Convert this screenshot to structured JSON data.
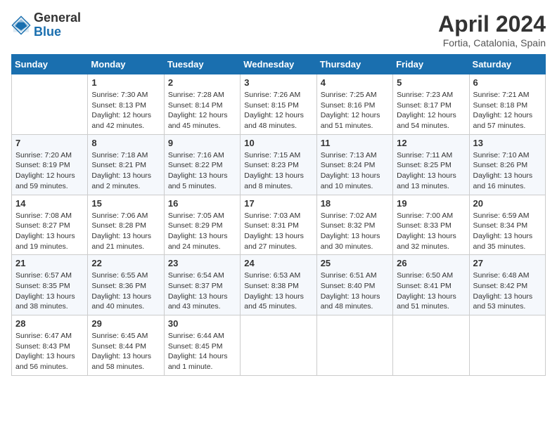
{
  "header": {
    "logo_general": "General",
    "logo_blue": "Blue",
    "month_title": "April 2024",
    "location": "Fortia, Catalonia, Spain"
  },
  "days_of_week": [
    "Sunday",
    "Monday",
    "Tuesday",
    "Wednesday",
    "Thursday",
    "Friday",
    "Saturday"
  ],
  "weeks": [
    [
      {
        "day": "",
        "info": ""
      },
      {
        "day": "1",
        "info": "Sunrise: 7:30 AM\nSunset: 8:13 PM\nDaylight: 12 hours\nand 42 minutes."
      },
      {
        "day": "2",
        "info": "Sunrise: 7:28 AM\nSunset: 8:14 PM\nDaylight: 12 hours\nand 45 minutes."
      },
      {
        "day": "3",
        "info": "Sunrise: 7:26 AM\nSunset: 8:15 PM\nDaylight: 12 hours\nand 48 minutes."
      },
      {
        "day": "4",
        "info": "Sunrise: 7:25 AM\nSunset: 8:16 PM\nDaylight: 12 hours\nand 51 minutes."
      },
      {
        "day": "5",
        "info": "Sunrise: 7:23 AM\nSunset: 8:17 PM\nDaylight: 12 hours\nand 54 minutes."
      },
      {
        "day": "6",
        "info": "Sunrise: 7:21 AM\nSunset: 8:18 PM\nDaylight: 12 hours\nand 57 minutes."
      }
    ],
    [
      {
        "day": "7",
        "info": "Sunrise: 7:20 AM\nSunset: 8:19 PM\nDaylight: 12 hours\nand 59 minutes."
      },
      {
        "day": "8",
        "info": "Sunrise: 7:18 AM\nSunset: 8:21 PM\nDaylight: 13 hours\nand 2 minutes."
      },
      {
        "day": "9",
        "info": "Sunrise: 7:16 AM\nSunset: 8:22 PM\nDaylight: 13 hours\nand 5 minutes."
      },
      {
        "day": "10",
        "info": "Sunrise: 7:15 AM\nSunset: 8:23 PM\nDaylight: 13 hours\nand 8 minutes."
      },
      {
        "day": "11",
        "info": "Sunrise: 7:13 AM\nSunset: 8:24 PM\nDaylight: 13 hours\nand 10 minutes."
      },
      {
        "day": "12",
        "info": "Sunrise: 7:11 AM\nSunset: 8:25 PM\nDaylight: 13 hours\nand 13 minutes."
      },
      {
        "day": "13",
        "info": "Sunrise: 7:10 AM\nSunset: 8:26 PM\nDaylight: 13 hours\nand 16 minutes."
      }
    ],
    [
      {
        "day": "14",
        "info": "Sunrise: 7:08 AM\nSunset: 8:27 PM\nDaylight: 13 hours\nand 19 minutes."
      },
      {
        "day": "15",
        "info": "Sunrise: 7:06 AM\nSunset: 8:28 PM\nDaylight: 13 hours\nand 21 minutes."
      },
      {
        "day": "16",
        "info": "Sunrise: 7:05 AM\nSunset: 8:29 PM\nDaylight: 13 hours\nand 24 minutes."
      },
      {
        "day": "17",
        "info": "Sunrise: 7:03 AM\nSunset: 8:31 PM\nDaylight: 13 hours\nand 27 minutes."
      },
      {
        "day": "18",
        "info": "Sunrise: 7:02 AM\nSunset: 8:32 PM\nDaylight: 13 hours\nand 30 minutes."
      },
      {
        "day": "19",
        "info": "Sunrise: 7:00 AM\nSunset: 8:33 PM\nDaylight: 13 hours\nand 32 minutes."
      },
      {
        "day": "20",
        "info": "Sunrise: 6:59 AM\nSunset: 8:34 PM\nDaylight: 13 hours\nand 35 minutes."
      }
    ],
    [
      {
        "day": "21",
        "info": "Sunrise: 6:57 AM\nSunset: 8:35 PM\nDaylight: 13 hours\nand 38 minutes."
      },
      {
        "day": "22",
        "info": "Sunrise: 6:55 AM\nSunset: 8:36 PM\nDaylight: 13 hours\nand 40 minutes."
      },
      {
        "day": "23",
        "info": "Sunrise: 6:54 AM\nSunset: 8:37 PM\nDaylight: 13 hours\nand 43 minutes."
      },
      {
        "day": "24",
        "info": "Sunrise: 6:53 AM\nSunset: 8:38 PM\nDaylight: 13 hours\nand 45 minutes."
      },
      {
        "day": "25",
        "info": "Sunrise: 6:51 AM\nSunset: 8:40 PM\nDaylight: 13 hours\nand 48 minutes."
      },
      {
        "day": "26",
        "info": "Sunrise: 6:50 AM\nSunset: 8:41 PM\nDaylight: 13 hours\nand 51 minutes."
      },
      {
        "day": "27",
        "info": "Sunrise: 6:48 AM\nSunset: 8:42 PM\nDaylight: 13 hours\nand 53 minutes."
      }
    ],
    [
      {
        "day": "28",
        "info": "Sunrise: 6:47 AM\nSunset: 8:43 PM\nDaylight: 13 hours\nand 56 minutes."
      },
      {
        "day": "29",
        "info": "Sunrise: 6:45 AM\nSunset: 8:44 PM\nDaylight: 13 hours\nand 58 minutes."
      },
      {
        "day": "30",
        "info": "Sunrise: 6:44 AM\nSunset: 8:45 PM\nDaylight: 14 hours\nand 1 minute."
      },
      {
        "day": "",
        "info": ""
      },
      {
        "day": "",
        "info": ""
      },
      {
        "day": "",
        "info": ""
      },
      {
        "day": "",
        "info": ""
      }
    ]
  ]
}
